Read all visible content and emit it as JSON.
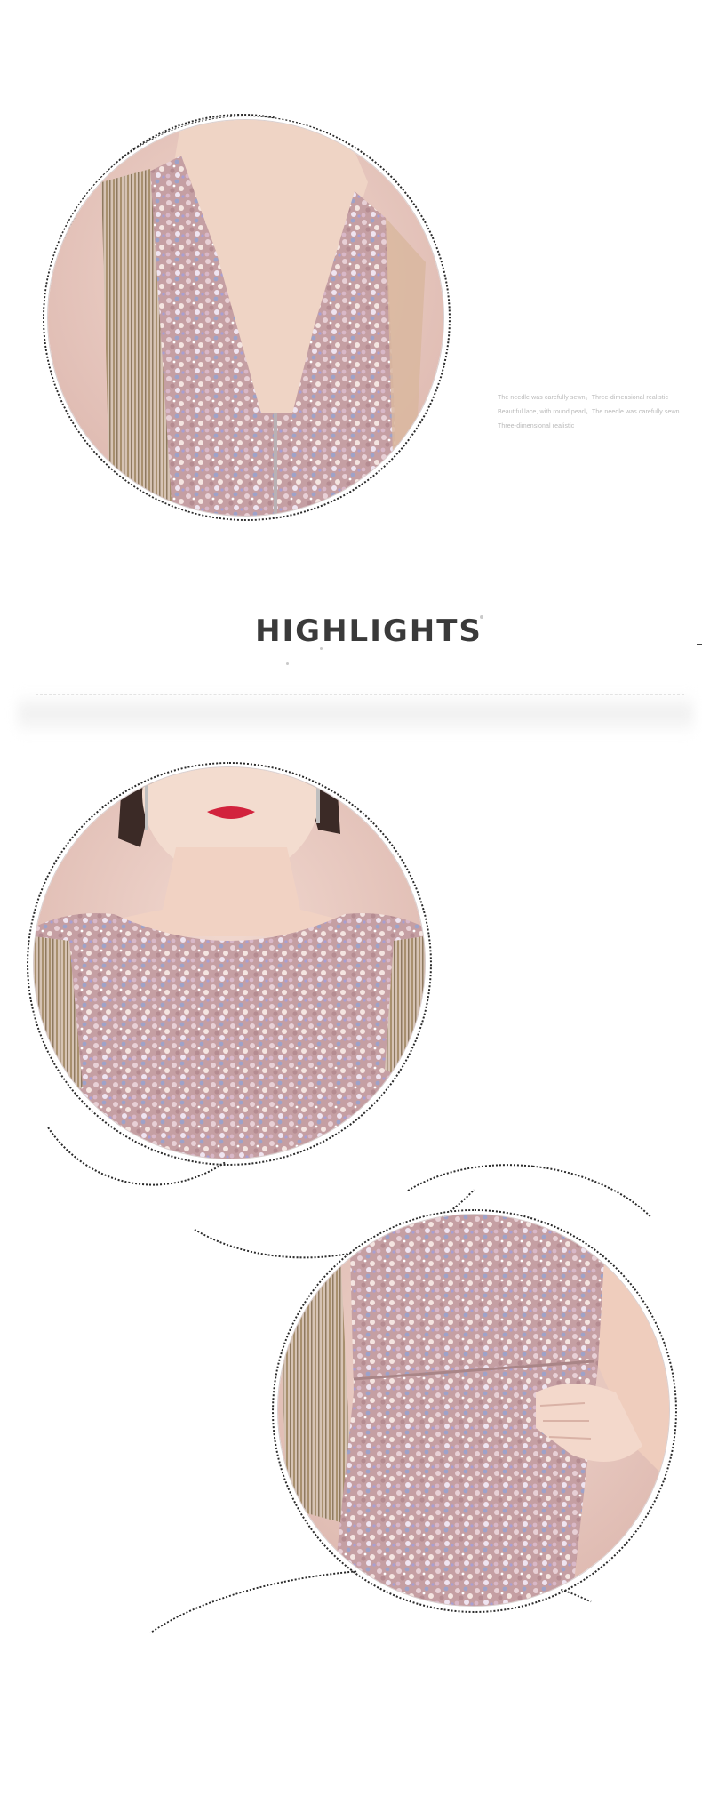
{
  "side_text": {
    "line1": "The needle was carefully sewn。Three-dimensional realistic",
    "line2": "Beautiful lace, with round pearl。The needle was carefully sewn",
    "line3": "Three-dimensional realistic"
  },
  "highlights": {
    "title": "HIGHLIGHTS"
  },
  "images": [
    {
      "name": "dress-back-view",
      "description": "Sequined pink dress back with V-neck and fringe sleeves"
    },
    {
      "name": "dress-front-neckline",
      "description": "Sequined pink dress boat neckline"
    },
    {
      "name": "dress-waist-detail",
      "description": "Sequined pink dress waist with hand on hip"
    }
  ],
  "colors": {
    "sequin_base": "#c9a3a6",
    "skin": "#f0d3c6",
    "background_wall": "#e9c7bd",
    "title": "#3a3a3a",
    "lips": "#d2233d"
  }
}
